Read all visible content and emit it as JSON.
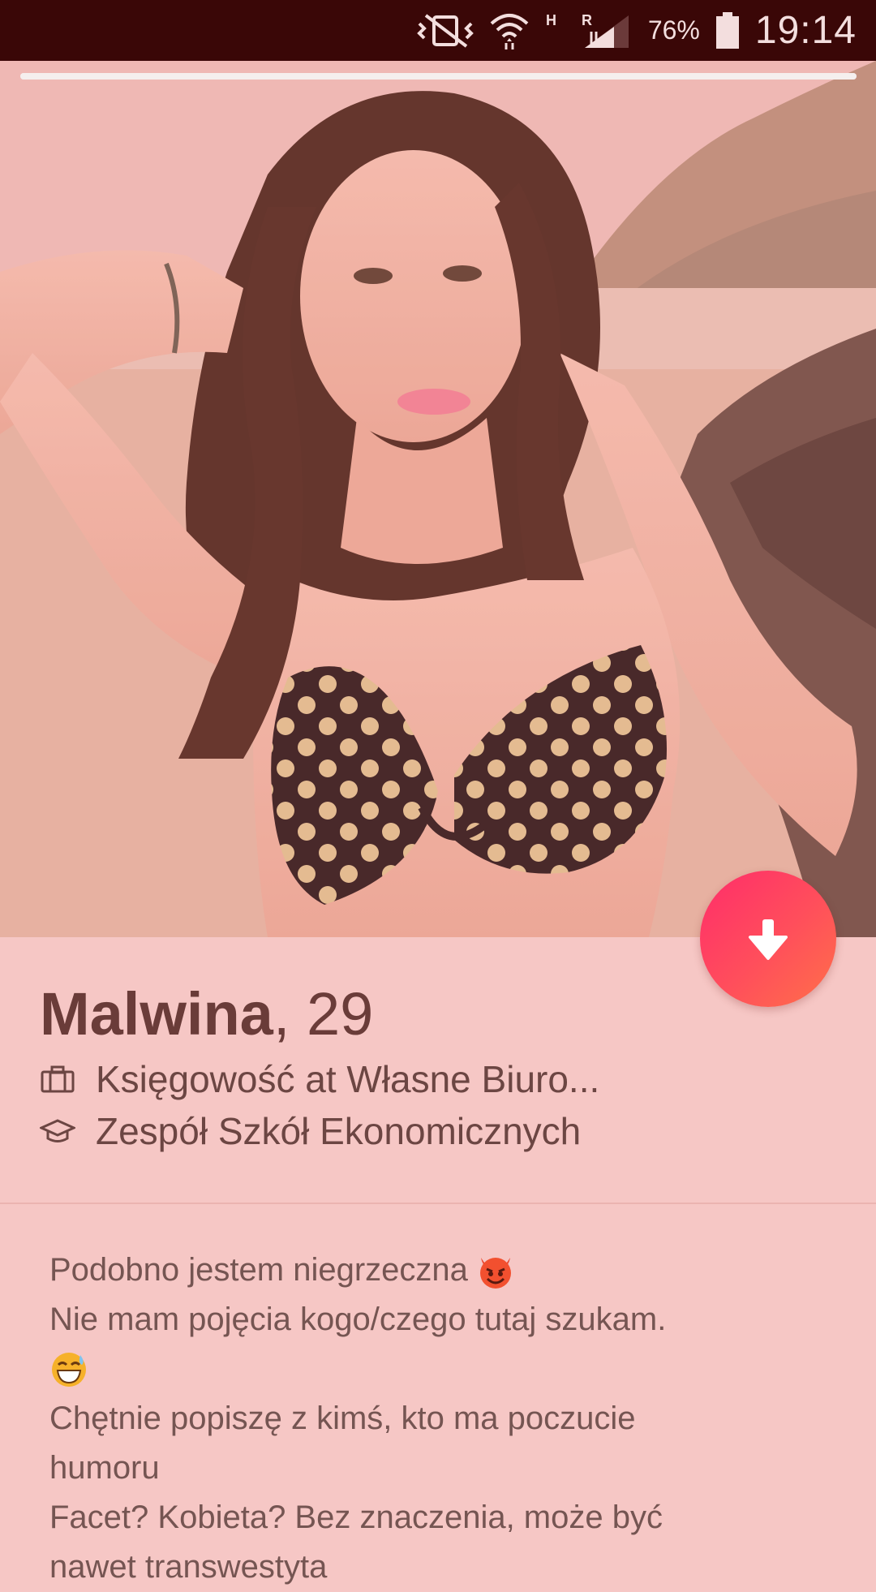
{
  "status_bar": {
    "battery_percent": "76%",
    "time": "19:14",
    "network_labels": {
      "h": "H",
      "r": "R"
    },
    "icons": [
      "vibrate-mute-icon",
      "wifi-icon",
      "signal-icon",
      "battery-icon"
    ]
  },
  "photo": {
    "description_icon": "profile-photo",
    "current_photo": 1,
    "photo_count": 1
  },
  "actions": {
    "fab_icon": "arrow-down-icon",
    "colors": {
      "fab_start": "#ff2d6a",
      "fab_end": "#ff7049"
    }
  },
  "profile": {
    "name": "Malwina",
    "separator": ", ",
    "age": "29",
    "job": "Księgowość at Własne Biuro...",
    "school": "Zespół Szkół Ekonomicznych",
    "job_icon": "briefcase-icon",
    "school_icon": "graduation-cap-icon"
  },
  "bio": {
    "line1": "Podobno jestem niegrzeczna",
    "line2": "Nie mam pojęcia kogo/czego tutaj szukam.",
    "line4": "Chętnie popiszę z kimś, kto ma poczucie",
    "line5": "humoru",
    "line6": "Facet? Kobieta? Bez znaczenia, może być",
    "line7": "nawet transwestyta",
    "emoji1": "smiling-devil-emoji",
    "emoji2": "grinning-sweat-emoji"
  },
  "colors": {
    "background": "#f6c7c5",
    "status_bar": "#3a0707",
    "name_text": "#6a3c39",
    "body_text": "#755552"
  }
}
